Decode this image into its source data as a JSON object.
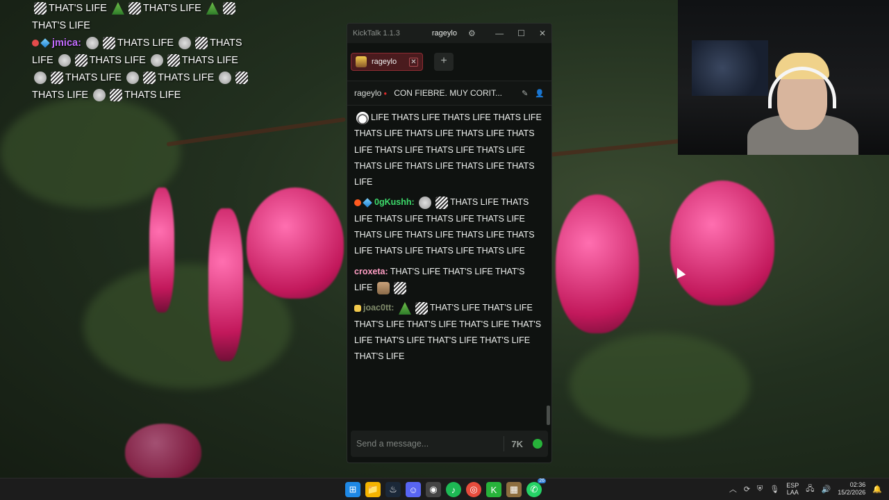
{
  "overlay_chat": {
    "line1": "THAT'S LIFE",
    "line1b": "THAT'S LIFE",
    "line2": "THAT'S LIFE",
    "msg_user": "jmica:",
    "msg_text": "THATS LIFE",
    "user_color": "#c26cff"
  },
  "kicktalk": {
    "app_name": "KickTalk 1.1.3",
    "active_user": "rageylo",
    "tab_label": "rageylo",
    "channel_user": "rageylo",
    "stream_title": "CON FIEBRE. MUY CORIT...",
    "input_placeholder": "Send a message...",
    "messages": [
      {
        "user": "",
        "text": "LIFE THATS LIFE THATS LIFE THATS LIFE THATS LIFE THATS LIFE THATS LIFE THATS LIFE THATS LIFE THATS LIFE THATS LIFE THATS LIFE THATS LIFE THATS LIFE THATS LIFE"
      },
      {
        "user": "0gKushh:",
        "text": "THATS LIFE THATS LIFE THATS LIFE THATS LIFE THATS LIFE THATS LIFE THATS LIFE THATS LIFE THATS LIFE THATS LIFE THATS LIFE THATS LIFE",
        "color": "#3ddc6b"
      },
      {
        "user": "croxeta:",
        "text": "THAT'S LIFE THAT'S LIFE THAT'S LIFE",
        "color": "#ff9ec4"
      },
      {
        "user": "joac0tt:",
        "text": "THAT'S LIFE THAT'S LIFE THAT'S LIFE THAT'S LIFE THAT'S LIFE THAT'S LIFE THAT'S LIFE THAT'S LIFE THAT'S LIFE THAT'S LIFE",
        "color": "#7f8a6a"
      }
    ]
  },
  "taskbar": {
    "lang_top": "ESP",
    "lang_bottom": "LAA",
    "time": "02:36",
    "date": "15/2/2026",
    "whatsapp_badge": "26"
  }
}
